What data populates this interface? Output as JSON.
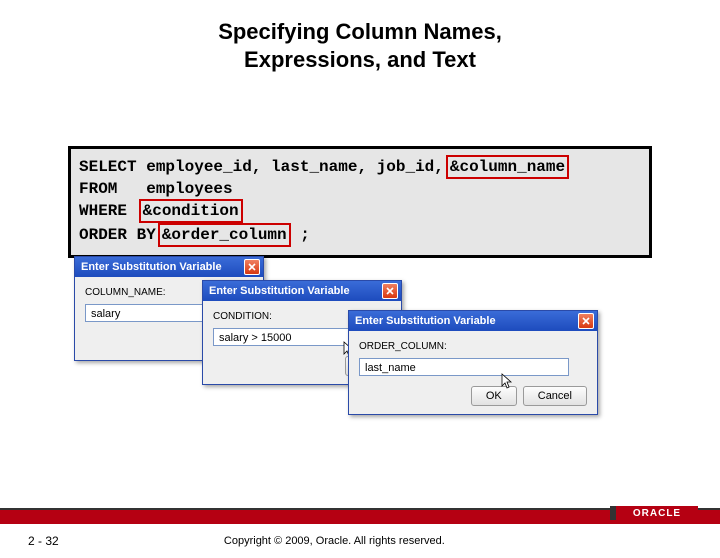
{
  "title_line1": "Specifying Column Names,",
  "title_line2": "Expressions, and Text",
  "sql": {
    "select_cols": "employee_id, last_name, job_id,",
    "sub_var_col": "&column_name",
    "from_line": "FROM   employees",
    "where_kw": "WHERE ",
    "sub_var_cond": "&condition",
    "order_kw": "ORDER BY",
    "sub_var_order": "&order_column",
    "terminator": " ;"
  },
  "dlg_title": "Enter Substitution Variable",
  "dlg1": {
    "prompt": "COLUMN_NAME:",
    "value": "salary"
  },
  "dlg2": {
    "prompt": "CONDITION:",
    "value": "salary > 15000"
  },
  "dlg3": {
    "prompt": "ORDER_COLUMN:",
    "value": "last_name"
  },
  "btn_ok": "OK",
  "btn_cancel": "Cancel",
  "page": "2 - 32",
  "copyright": "Copyright © 2009, Oracle. All rights reserved.",
  "logo": "ORACLE"
}
